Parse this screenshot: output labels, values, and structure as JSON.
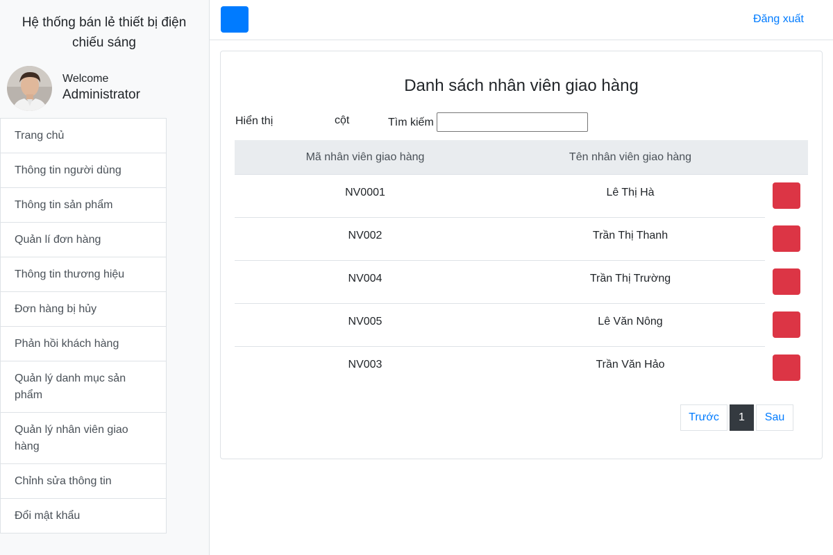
{
  "sidebar": {
    "brand": "Hệ thống bán lẻ thiết bị điện chiếu sáng",
    "welcome": "Welcome",
    "user": "Administrator",
    "items": [
      {
        "label": "Trang chủ"
      },
      {
        "label": "Thông tin người dùng"
      },
      {
        "label": "Thông tin sản phẩm"
      },
      {
        "label": "Quản lí đơn hàng"
      },
      {
        "label": "Thông tin thương hiệu"
      },
      {
        "label": "Đơn hàng bị hủy"
      },
      {
        "label": "Phản hồi khách hàng"
      },
      {
        "label": "Quản lý danh mục sản phẩm"
      },
      {
        "label": "Quản lý nhân viên giao hàng"
      },
      {
        "label": "Chỉnh sửa thông tin"
      },
      {
        "label": "Đổi mật khẩu"
      }
    ]
  },
  "topbar": {
    "logout": "Đăng xuất",
    "toggle_color": "#007bff"
  },
  "main": {
    "title": "Danh sách nhân viên giao hàng",
    "show_label": "Hiển thị",
    "col_label": "cột",
    "search_label": "Tìm kiếm",
    "search_value": "",
    "columns": [
      "Mã nhân viên giao hàng",
      "Tên nhân viên giao hàng"
    ],
    "rows": [
      {
        "id": "NV0001",
        "name": "Lê Thị Hà"
      },
      {
        "id": "NV002",
        "name": "Trần Thị Thanh"
      },
      {
        "id": "NV004",
        "name": "Trần Thị Trường"
      },
      {
        "id": "NV005",
        "name": "Lê Văn Nông"
      },
      {
        "id": "NV003",
        "name": "Trần Văn Hảo"
      }
    ],
    "delete_color": "#dc3545"
  },
  "pagination": {
    "prev": "Trước",
    "current": "1",
    "next": "Sau"
  }
}
